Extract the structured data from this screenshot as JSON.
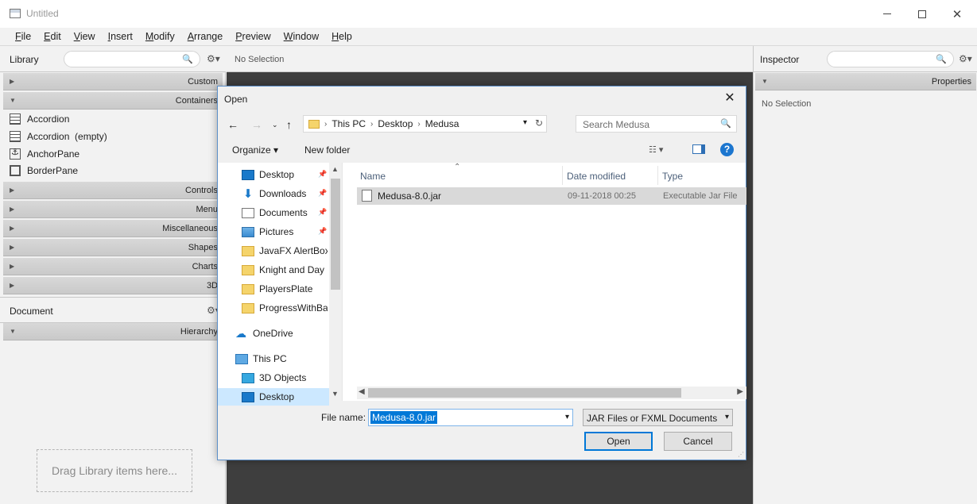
{
  "window": {
    "title": "Untitled"
  },
  "menubar": {
    "items": [
      {
        "label": "File",
        "mnemonic": "F",
        "rest": "ile"
      },
      {
        "label": "Edit",
        "mnemonic": "E",
        "rest": "dit"
      },
      {
        "label": "View",
        "mnemonic": "V",
        "rest": "iew"
      },
      {
        "label": "Insert",
        "mnemonic": "I",
        "rest": "nsert"
      },
      {
        "label": "Modify",
        "mnemonic": "M",
        "rest": "odify"
      },
      {
        "label": "Arrange",
        "mnemonic": "A",
        "rest": "rrange"
      },
      {
        "label": "Preview",
        "mnemonic": "P",
        "rest": "review"
      },
      {
        "label": "Window",
        "mnemonic": "W",
        "rest": "indow"
      },
      {
        "label": "Help",
        "mnemonic": "H",
        "rest": "elp"
      }
    ]
  },
  "library": {
    "title": "Library",
    "sections": [
      "Custom",
      "Containers",
      "Controls",
      "Menu",
      "Miscellaneous",
      "Shapes",
      "Charts",
      "3D"
    ],
    "items": [
      "Accordion",
      "Accordion  (empty)",
      "AnchorPane",
      "BorderPane"
    ]
  },
  "document": {
    "title": "Document",
    "section": "Hierarchy",
    "drag_hint": "Drag Library items here..."
  },
  "center": {
    "no_selection": "No Selection"
  },
  "inspector": {
    "title": "Inspector",
    "section": "Properties",
    "no_selection": "No Selection"
  },
  "dialog": {
    "title": "Open",
    "breadcrumb": [
      "This PC",
      "Desktop",
      "Medusa"
    ],
    "search_placeholder": "Search Medusa",
    "organize": "Organize",
    "new_folder": "New folder",
    "nav": [
      {
        "label": "Desktop",
        "icon": "desktop-icon",
        "pinned": true
      },
      {
        "label": "Downloads",
        "icon": "download-icon",
        "pinned": true
      },
      {
        "label": "Documents",
        "icon": "documents-icon",
        "pinned": true
      },
      {
        "label": "Pictures",
        "icon": "pictures-icon",
        "pinned": true
      },
      {
        "label": "JavaFX AlertBox",
        "icon": "folder-icon",
        "pinned": false
      },
      {
        "label": "Knight and Day",
        "icon": "folder-icon",
        "pinned": false
      },
      {
        "label": "PlayersPlate",
        "icon": "folder-icon",
        "pinned": false
      },
      {
        "label": "ProgressWithBac",
        "icon": "folder-icon",
        "pinned": false
      },
      {
        "label": "OneDrive",
        "icon": "onedrive-icon",
        "pinned": false
      },
      {
        "label": "This PC",
        "icon": "this-pc-icon",
        "pinned": false
      },
      {
        "label": "3D Objects",
        "icon": "3d-objects-icon",
        "pinned": false
      },
      {
        "label": "Desktop",
        "icon": "desktop-icon",
        "pinned": false
      }
    ],
    "columns": [
      "Name",
      "Date modified",
      "Type"
    ],
    "files": [
      {
        "name": "Medusa-8.0.jar",
        "date": "09-11-2018 00:25",
        "type": "Executable Jar File"
      }
    ],
    "file_name_label": "File name:",
    "file_name_value": "Medusa-8.0.jar",
    "filter": "JAR Files or FXML Documents (",
    "open": "Open",
    "cancel": "Cancel"
  }
}
